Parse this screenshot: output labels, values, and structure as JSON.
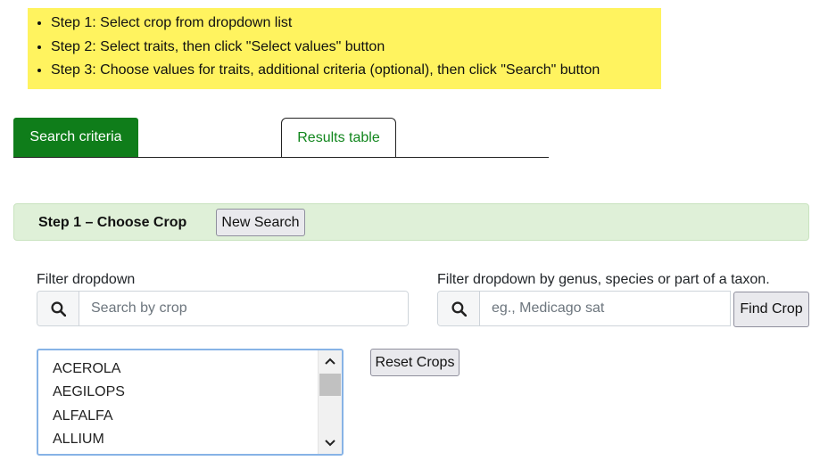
{
  "instructions": {
    "steps": [
      "Step 1: Select crop from dropdown list",
      "Step 2: Select traits, then click \"Select values\" button",
      "Step 3: Choose values for traits, additional criteria (optional), then click \"Search\" button"
    ]
  },
  "tabs": [
    {
      "label": "Search criteria",
      "active": true
    },
    {
      "label": "Results table",
      "active": false
    }
  ],
  "step1": {
    "title": "Step 1 – Choose Crop",
    "new_search_label": "New Search"
  },
  "filter": {
    "label": "Filter dropdown",
    "placeholder": "Search by crop",
    "icon": "search-icon"
  },
  "taxon_filter": {
    "label": "Filter dropdown by genus, species or part of a taxon.",
    "placeholder": "eg., Medicago sat",
    "icon": "search-icon",
    "button_label": "Find Crop"
  },
  "reset_label": "Reset Crops",
  "crops": {
    "items": [
      "ACEROLA",
      "AEGILOPS",
      "ALFALFA",
      "ALLIUM"
    ]
  },
  "colors": {
    "instructions_bg": "#fff35f",
    "active_tab_bg": "#0f7d1a",
    "inactive_tab_text": "#11861d",
    "step_bar_bg": "#dff0d8",
    "listbox_focus_border": "#87b3e6"
  }
}
